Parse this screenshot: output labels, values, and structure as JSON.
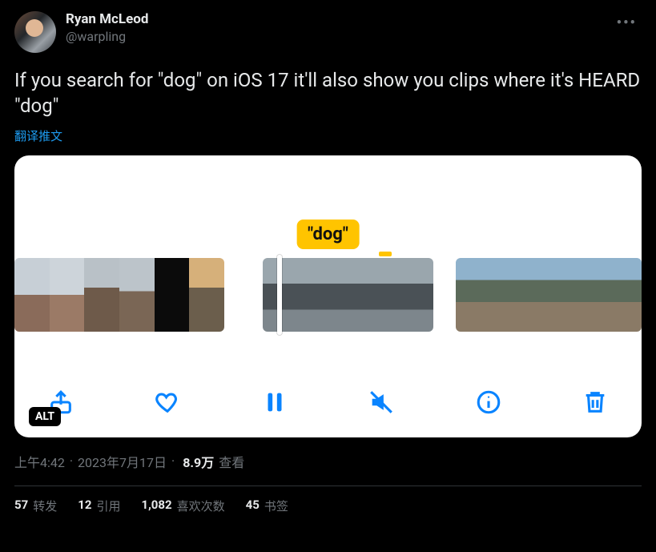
{
  "author": {
    "display_name": "Ryan McLeod",
    "handle": "@warpling"
  },
  "tweet_text": "If you search for \"dog\" on iOS 17 it'll also show you clips where it's HEARD \"dog\"",
  "translate_label": "翻译推文",
  "media": {
    "search_term_display": "\"dog\"",
    "alt_badge": "ALT"
  },
  "meta": {
    "time": "上午4:42",
    "date": "2023年7月17日",
    "views_count": "8.9万",
    "views_label": "查看",
    "separator": "·"
  },
  "stats": {
    "retweets_count": "57",
    "retweets_label": "转发",
    "quotes_count": "12",
    "quotes_label": "引用",
    "likes_count": "1,082",
    "likes_label": "喜欢次数",
    "bookmarks_count": "45",
    "bookmarks_label": "书签"
  }
}
